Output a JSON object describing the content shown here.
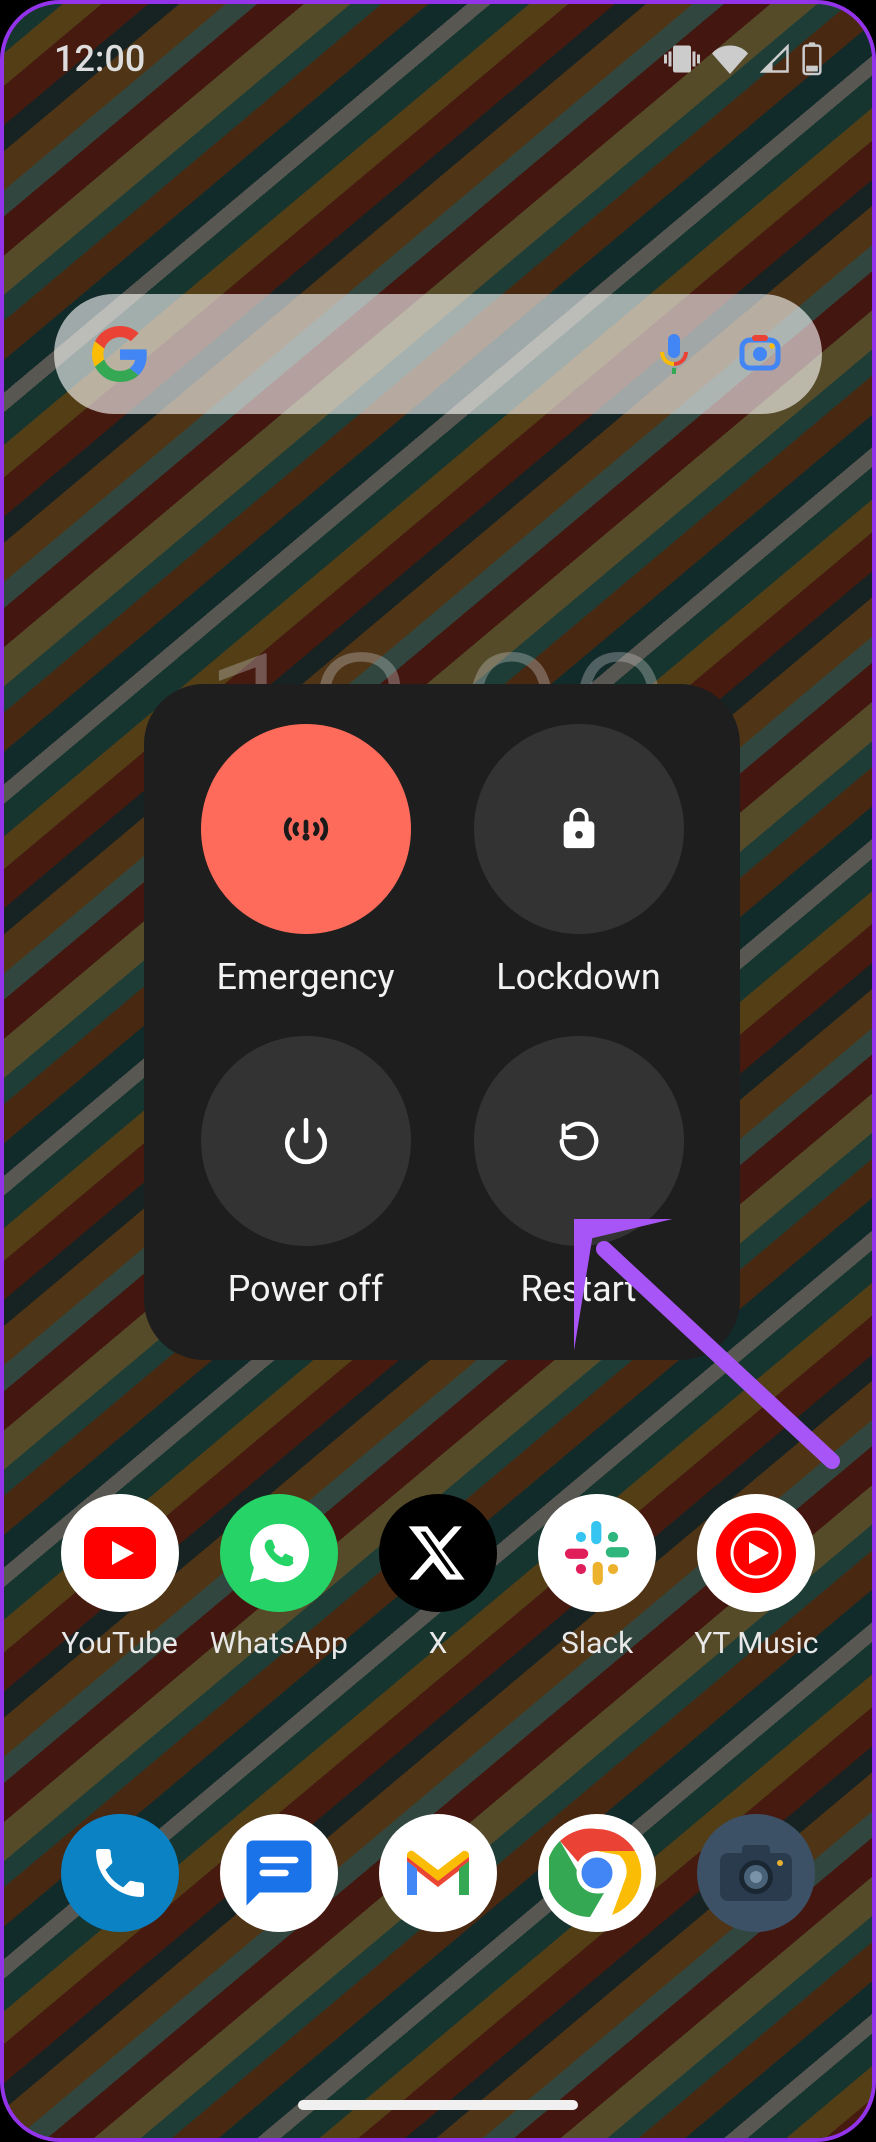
{
  "status": {
    "time": "12:00"
  },
  "clock": "12:00",
  "power_menu": {
    "emergency": "Emergency",
    "lockdown": "Lockdown",
    "power_off": "Power off",
    "restart": "Restart"
  },
  "apps": {
    "youtube": "YouTube",
    "whatsapp": "WhatsApp",
    "x": "X",
    "slack": "Slack",
    "ytmusic": "YT Music"
  },
  "colors": {
    "emergency": "#ff6b5b",
    "annotation": "#a855f7"
  }
}
